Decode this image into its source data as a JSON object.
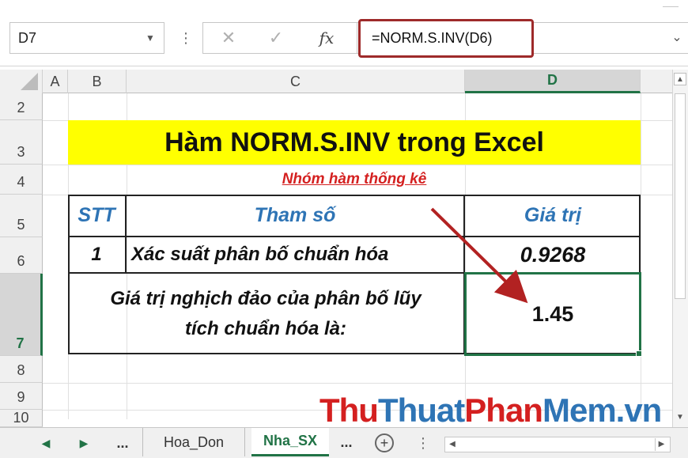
{
  "formula_bar": {
    "name_box": "D7",
    "cancel_icon": "x-icon",
    "enter_icon": "check-icon",
    "function_label": "fx",
    "formula": "=NORM.S.INV(D6)"
  },
  "columns": [
    "A",
    "B",
    "C",
    "D"
  ],
  "active_column": "D",
  "rows": [
    "2",
    "3",
    "4",
    "5",
    "6",
    "7",
    "8",
    "9",
    "10"
  ],
  "active_row": "7",
  "sheet": {
    "title": "Hàm NORM.S.INV trong Excel",
    "subtitle": "Nhóm hàm thống kê",
    "table": {
      "headers": {
        "stt": "STT",
        "param": "Tham số",
        "value": "Giá trị"
      },
      "row1": {
        "stt": "1",
        "param": "Xác suất phân bố chuẩn hóa",
        "value": "0.9268"
      },
      "result": {
        "label_line1": "Giá trị nghịch đảo của phân bố lũy",
        "label_line2": "tích chuẩn hóa là:",
        "value": "1.45"
      }
    }
  },
  "tabs": {
    "nav_prev": "◀",
    "nav_next": "▶",
    "nav_more": "...",
    "sheets": [
      "Hoa_Don",
      "Nha_SX"
    ],
    "active_sheet": "Nha_SX",
    "more": "...",
    "add": "+"
  },
  "watermark": {
    "part1": "Thu",
    "part2": "Thuat",
    "part3": "Phan",
    "part4": "Mem.vn"
  },
  "colors": {
    "excel_green": "#217346",
    "title_fill": "#ffff00",
    "header_blue": "#2e74b5",
    "subtitle_red": "#d42020",
    "highlight_border": "#9e2a2a",
    "arrow": "#b22222"
  }
}
